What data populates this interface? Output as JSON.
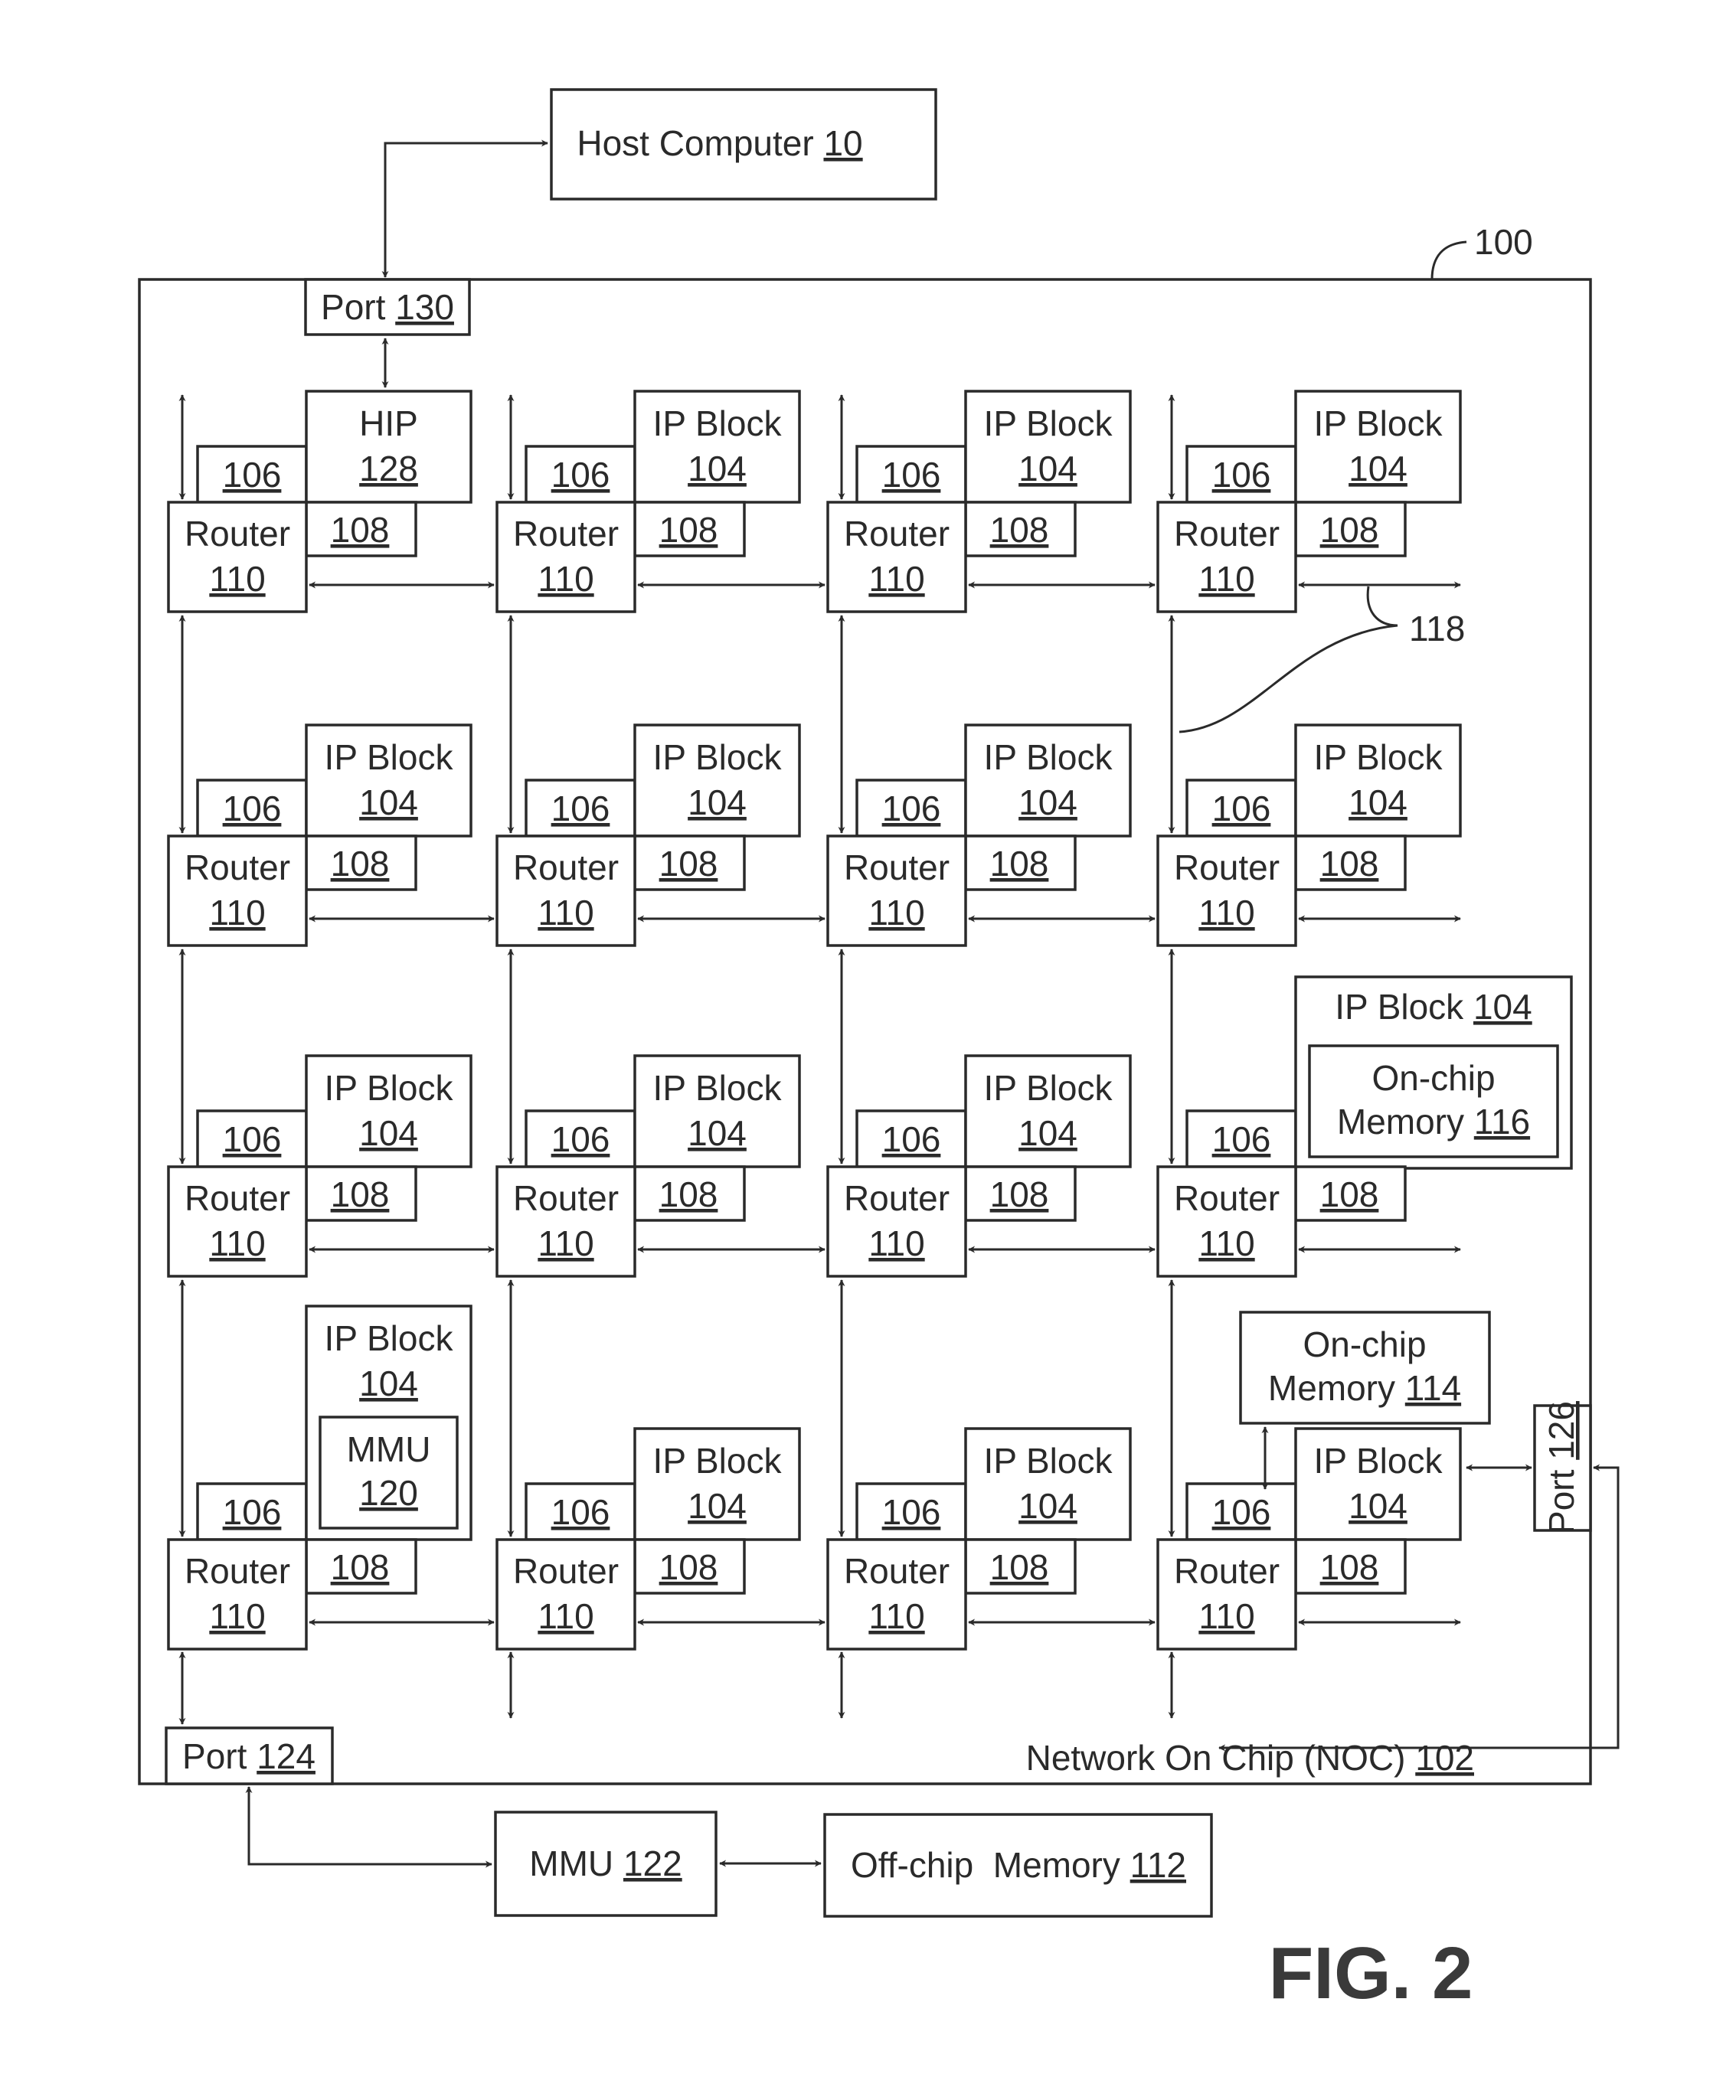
{
  "figure": {
    "title": "FIG. 2",
    "chip_ref": "100",
    "link_ref": "118"
  },
  "host": {
    "label": "Host Computer",
    "ref": "10"
  },
  "noc": {
    "label": "Network On Chip (NOC)",
    "ref": "102"
  },
  "ports": {
    "p130": {
      "label": "Port",
      "ref": "130"
    },
    "p124": {
      "label": "Port",
      "ref": "124"
    },
    "p126": {
      "label": "Port",
      "ref": "126"
    }
  },
  "external": {
    "mmu": {
      "label": "MMU",
      "ref": "122"
    },
    "offchip": {
      "label": "Off-chip  Memory",
      "ref": "112"
    }
  },
  "onchip114": {
    "line1": "On-chip",
    "line2": "Memory",
    "ref": "114"
  },
  "node_common": {
    "router_label": "Router",
    "router_ref": "110",
    "interface_ref": "106",
    "controller_ref": "108"
  },
  "grid": [
    [
      {
        "type": "hip",
        "line1": "HIP",
        "ref": "128"
      },
      {
        "type": "ip",
        "line1": "IP Block",
        "ref": "104"
      },
      {
        "type": "ip",
        "line1": "IP Block",
        "ref": "104"
      },
      {
        "type": "ip",
        "line1": "IP Block",
        "ref": "104"
      }
    ],
    [
      {
        "type": "ip",
        "line1": "IP Block",
        "ref": "104"
      },
      {
        "type": "ip",
        "line1": "IP Block",
        "ref": "104"
      },
      {
        "type": "ip",
        "line1": "IP Block",
        "ref": "104"
      },
      {
        "type": "ip",
        "line1": "IP Block",
        "ref": "104"
      }
    ],
    [
      {
        "type": "ip",
        "line1": "IP Block",
        "ref": "104"
      },
      {
        "type": "ip",
        "line1": "IP Block",
        "ref": "104"
      },
      {
        "type": "ip",
        "line1": "IP Block",
        "ref": "104"
      },
      {
        "type": "ip-mem",
        "line1": "IP Block",
        "ref": "104",
        "inner_line1": "On-chip",
        "inner_line2": "Memory",
        "inner_ref": "116"
      }
    ],
    [
      {
        "type": "ip-mmu",
        "line1": "IP Block",
        "ref": "104",
        "inner_line1": "MMU",
        "inner_ref": "120"
      },
      {
        "type": "ip",
        "line1": "IP Block",
        "ref": "104"
      },
      {
        "type": "ip",
        "line1": "IP Block",
        "ref": "104"
      },
      {
        "type": "ip",
        "line1": "IP Block",
        "ref": "104"
      }
    ]
  ]
}
